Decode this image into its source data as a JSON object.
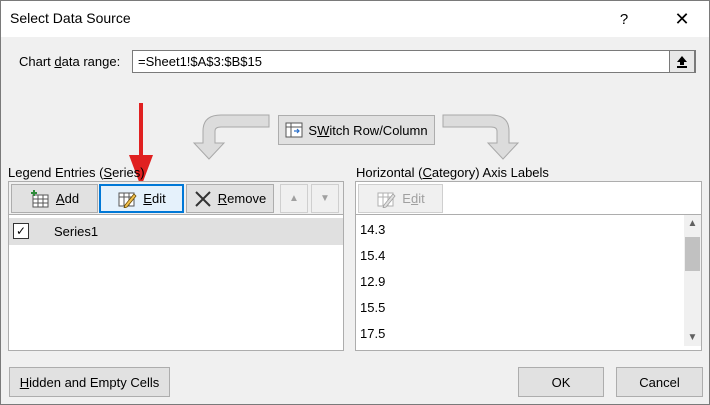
{
  "window": {
    "title": "Select Data Source",
    "help_label": "?",
    "close_label": "✕"
  },
  "range": {
    "label_prefix": "Chart ",
    "label_underlined": "d",
    "label_suffix": "ata range:",
    "value": "=Sheet1!$A$3:$B$15"
  },
  "switch": {
    "label_underlined": "W",
    "label_prefix": "S",
    "label_suffix": "itch Row/Column"
  },
  "legend": {
    "heading_prefix": "Legend Entries (",
    "heading_underlined": "S",
    "heading_suffix": "eries)",
    "add_underlined": "A",
    "add_suffix": "dd",
    "edit_underlined": "E",
    "edit_suffix": "dit",
    "remove_underlined": "R",
    "remove_suffix": "emove",
    "up_icon": "▲",
    "down_icon": "▼",
    "series": [
      {
        "name": "Series1",
        "checked": true,
        "check_mark": "✓"
      }
    ]
  },
  "axis": {
    "heading_prefix": "Horizontal (",
    "heading_underlined": "C",
    "heading_suffix": "ategory) Axis Labels",
    "edit_underlined": "d",
    "edit_prefix": "E",
    "edit_suffix": "it",
    "items": [
      "14.3",
      "15.4",
      "12.9",
      "15.5",
      "17.5"
    ]
  },
  "footer": {
    "hidden_underlined": "H",
    "hidden_suffix": "idden and Empty Cells",
    "ok_label": "OK",
    "cancel_label": "Cancel"
  },
  "colors": {
    "annotation_arrow": "#e02020",
    "focus_border": "#0078d7"
  }
}
